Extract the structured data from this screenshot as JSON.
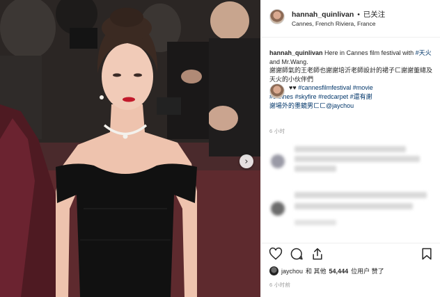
{
  "post": {
    "username": "hannah_quinlivan",
    "dot": "•",
    "follow_status": "已关注",
    "location": "Cannes, French Riviera, France",
    "caption": {
      "username": "hannah_quinlivan",
      "line1_text": "Here in Cannes film festival with",
      "line1_tag": "#天火",
      "line1_rest": "and Mr.Wang.",
      "line2": "謝謝師氣的王老師也謝謝培沂老師設計的裙子ㄈ謝謝董總及天火的小伙伴們",
      "line3_hearts": "♥♥",
      "tags_line3": [
        "#cannesfilmfestival",
        "#movie"
      ],
      "tags_line4": [
        "#cannes",
        "#skyfire",
        "#redcarpet",
        "#還有謝"
      ],
      "line5_text": "謝場外的墨鏡男ㄈㄈ",
      "line5_mention": "@jaychou"
    },
    "caption_time": "6 小时",
    "likes": {
      "liker": "jaychou",
      "text_and": "和 其他",
      "count": "54,444",
      "text_suffix": "位用户 赞了"
    },
    "post_time": "6 小时前"
  },
  "photo": {
    "next_button_icon": "chevron-right-icon",
    "next_button_label": "›"
  },
  "icons": {
    "like": "heart-icon",
    "comment": "comment-icon",
    "share": "share-icon",
    "save": "bookmark-icon"
  },
  "colors": {
    "tag": "#003569",
    "dress": "#111111",
    "lips": "#c2192b",
    "border": "#efefef"
  }
}
